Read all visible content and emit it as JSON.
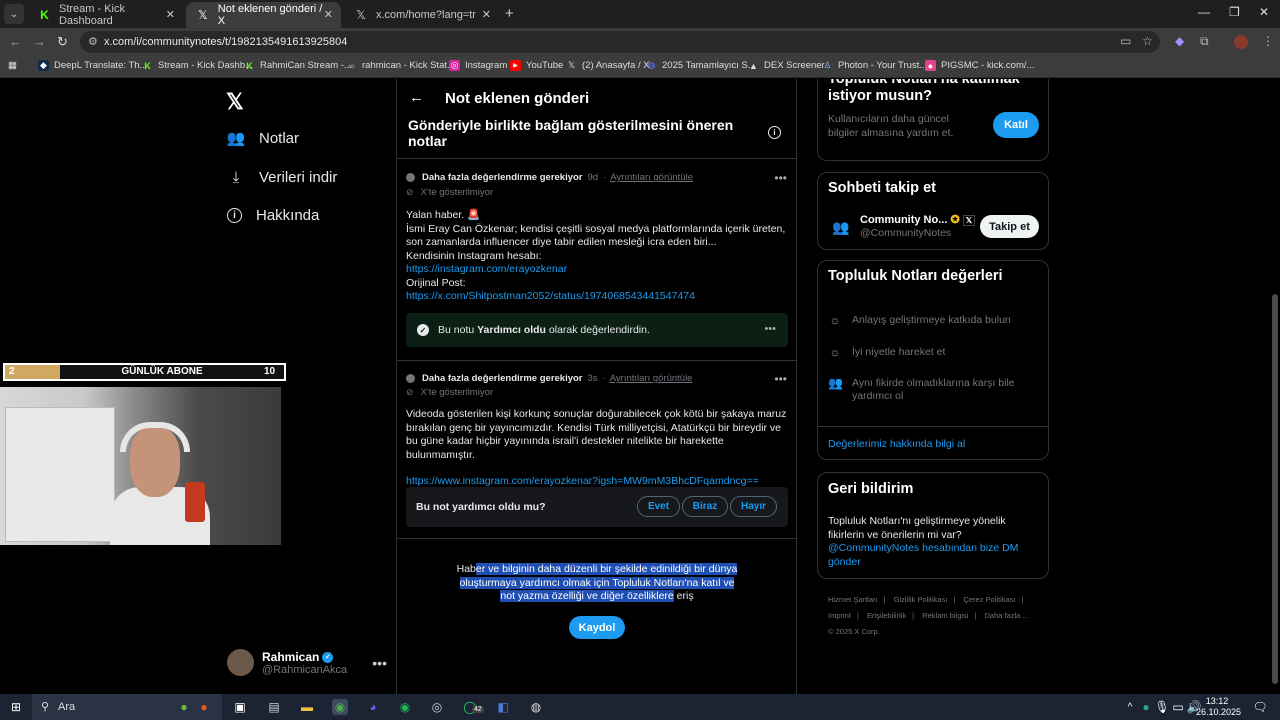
{
  "tabs": [
    {
      "title": "Stream - Kick Dashboard",
      "icon": "kick-icon",
      "color": "#53fc18"
    },
    {
      "title": "Not eklenen gönderi / X",
      "icon": "x-logo-icon",
      "active": true
    },
    {
      "title": "x.com/home?lang=tr",
      "icon": "x-logo-icon"
    }
  ],
  "url": "x.com/i/communitynotes/t/1982135491613925804",
  "bookmarks": [
    {
      "label": "DeepL Translate: Th...",
      "icon": "deepl-icon"
    },
    {
      "label": "Stream - Kick Dashb...",
      "icon": "kick-icon"
    },
    {
      "label": "RahmiCan Stream -...",
      "icon": "kick-icon"
    },
    {
      "label": "rahmican - Kick Stat...",
      "icon": "stats-icon"
    },
    {
      "label": "Instagram",
      "icon": "instagram-icon"
    },
    {
      "label": "YouTube",
      "icon": "youtube-icon"
    },
    {
      "label": "(2) Anasayfa / X",
      "icon": "x-logo-icon"
    },
    {
      "label": "2025 Tamamlayıcı S...",
      "icon": "globe-icon"
    },
    {
      "label": "DEX Screener",
      "icon": "dex-icon"
    },
    {
      "label": "Photon - Your Trust...",
      "icon": "photon-icon"
    },
    {
      "label": "PIGSMC - kick.com/...",
      "icon": "pig-icon"
    }
  ],
  "nav": {
    "items": [
      {
        "label": "Notlar",
        "icon": "people-icon"
      },
      {
        "label": "Verileri indir",
        "icon": "download-icon"
      },
      {
        "label": "Hakkında",
        "icon": "info-icon"
      }
    ],
    "profile": {
      "name": "Rahmican",
      "handle": "@RahmicanAkca"
    }
  },
  "overlay": {
    "count": "2",
    "title": "GÜNLÜK ABONE",
    "goal": "10"
  },
  "header": {
    "title": "Not eklenen gönderi",
    "subtitle": "Gönderiyle birlikte bağlam gösterilmesini öneren notlar"
  },
  "notes": [
    {
      "status": "Daha fazla değerlendirme gerekiyor",
      "age": "9d",
      "details": "Ayrıntıları görüntüle",
      "visibility": "X'te gösterilmiyor",
      "lines": [
        "Yalan haber. 🚨",
        "İsmi Eray Can Özkenar; kendisi çeşitli sosyal medya platformlarında içerik üreten,",
        "son zamanlarda influencer diye tabir edilen mesleği icra eden biri...",
        "Kendisinin Instagram hesabı:"
      ],
      "link1": "https://instagram.com/erayozkenar",
      "orig_label": "Orijinal Post:",
      "link2": "https://x.com/Shitpostman2052/status/1974068543441547474",
      "rated_prefix": "Bu notu",
      "rated_bold": "Yardımcı oldu",
      "rated_suffix": "olarak değerlendirdin."
    },
    {
      "status": "Daha fazla değerlendirme gerekiyor",
      "age": "3s",
      "details": "Ayrıntıları görüntüle",
      "visibility": "X'te gösterilmiyor",
      "text": "Videoda gösterilen kişi korkunç sonuçlar doğurabilecek çok kötü bir şakaya maruz bırakılan genç bir yayıncımızdır. Kendisi Türk milliyetçisi, Atatürkçü bir bireydir ve bu güne kadar hiçbir yayınında israil'i destekler nitelikte bir harekette bulunmamıştır.",
      "link": "https://www.instagram.com/erayozkenar?igsh=MW9mM3BhcDFqamdncg==",
      "question": "Bu not yardımcı oldu mu?",
      "options": [
        "Evet",
        "Biraz",
        "Hayır"
      ]
    }
  ],
  "signup": {
    "text_plain_start": "Hab",
    "text_highlight": "er ve bilginin daha düzenli bir şekilde edinildiği bir dünya oluşturmaya yardımcı olmak için Topluluk Notları'na katıl ve not yazma özelliği ve diğer özelliklere",
    "text_plain_end": " eriş",
    "button": "Kaydol"
  },
  "right": {
    "join": {
      "title": "Topluluk Notları'na katılmak istiyor musun?",
      "text": "Kullanıcıların daha güncel bilgiler almasına yardım et.",
      "button": "Katıl"
    },
    "follow": {
      "title": "Sohbeti takip et",
      "name": "Community No...",
      "handle": "@CommunityNotes",
      "button": "Takip et"
    },
    "values": {
      "title": "Topluluk Notları değerleri",
      "items": [
        {
          "text": "Anlayış geliştirmeye katkıda bulun",
          "icon": "sun-icon"
        },
        {
          "text": "İyi niyetle hareket et",
          "icon": "sun-icon"
        },
        {
          "text": "Aynı fikirde olmadıklarına karşı bile yardımcı ol",
          "icon": "people-icon"
        }
      ],
      "link": "Değerlerimiz hakkında bilgi al"
    },
    "feedback": {
      "title": "Geri bildirim",
      "text": "Topluluk Notları'nı geliştirmeye yönelik fikirlerin ve önerilerin mi var?",
      "link": "@CommunityNotes hesabından bize DM gönder"
    },
    "footer": [
      "Hizmet Şartları",
      "Gizlilik Politikası",
      "Çerez Politikası",
      "Imprint",
      "Erişilebilirlik",
      "Reklam bilgisi",
      "Daha fazla ...",
      "© 2025 X Corp."
    ]
  },
  "taskbar": {
    "search": "Ara",
    "time": "13:12",
    "date": "26.10.2025",
    "whatsapp_badge": "42"
  }
}
